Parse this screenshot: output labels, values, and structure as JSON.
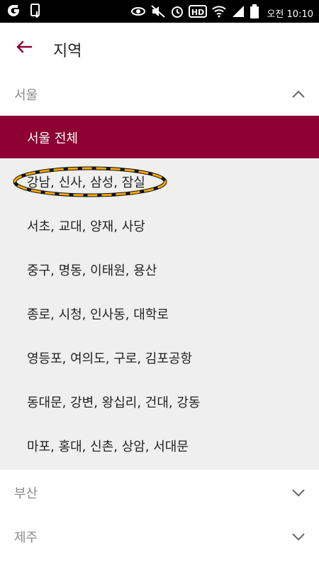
{
  "status_bar": {
    "time": "오전 10:10",
    "icons": [
      "app-notification-icon",
      "download-icon",
      "eye-icon",
      "mute-icon",
      "alarm-icon",
      "hd-icon",
      "wifi-icon",
      "signal-icon",
      "battery-icon"
    ]
  },
  "app_bar": {
    "title": "지역",
    "back_icon": "back-arrow-icon"
  },
  "colors": {
    "accent": "#8c0032",
    "list_bg": "#efefef",
    "header_text": "#8a8a8a",
    "highlight": "#f5a800"
  },
  "regions": [
    {
      "label": "서울",
      "expanded": true,
      "chevron": "chevron-up-icon",
      "sub_items": [
        {
          "label": "서울 전체",
          "selected": true
        },
        {
          "label": "강남, 신사, 삼성, 잠실",
          "selected": false
        },
        {
          "label": "서초, 교대, 양재, 사당",
          "selected": false
        },
        {
          "label": "중구, 명동, 이태원, 용산",
          "selected": false
        },
        {
          "label": "종로, 시청, 인사동, 대학로",
          "selected": false
        },
        {
          "label": "영등포, 여의도, 구로, 김포공항",
          "selected": false
        },
        {
          "label": "동대문, 강변, 왕십리, 건대, 강동",
          "selected": false
        },
        {
          "label": "마포, 홍대, 신촌, 상암, 서대문",
          "selected": false
        }
      ]
    },
    {
      "label": "부산",
      "expanded": false,
      "chevron": "chevron-down-icon"
    },
    {
      "label": "제주",
      "expanded": false,
      "chevron": "chevron-down-icon"
    }
  ]
}
